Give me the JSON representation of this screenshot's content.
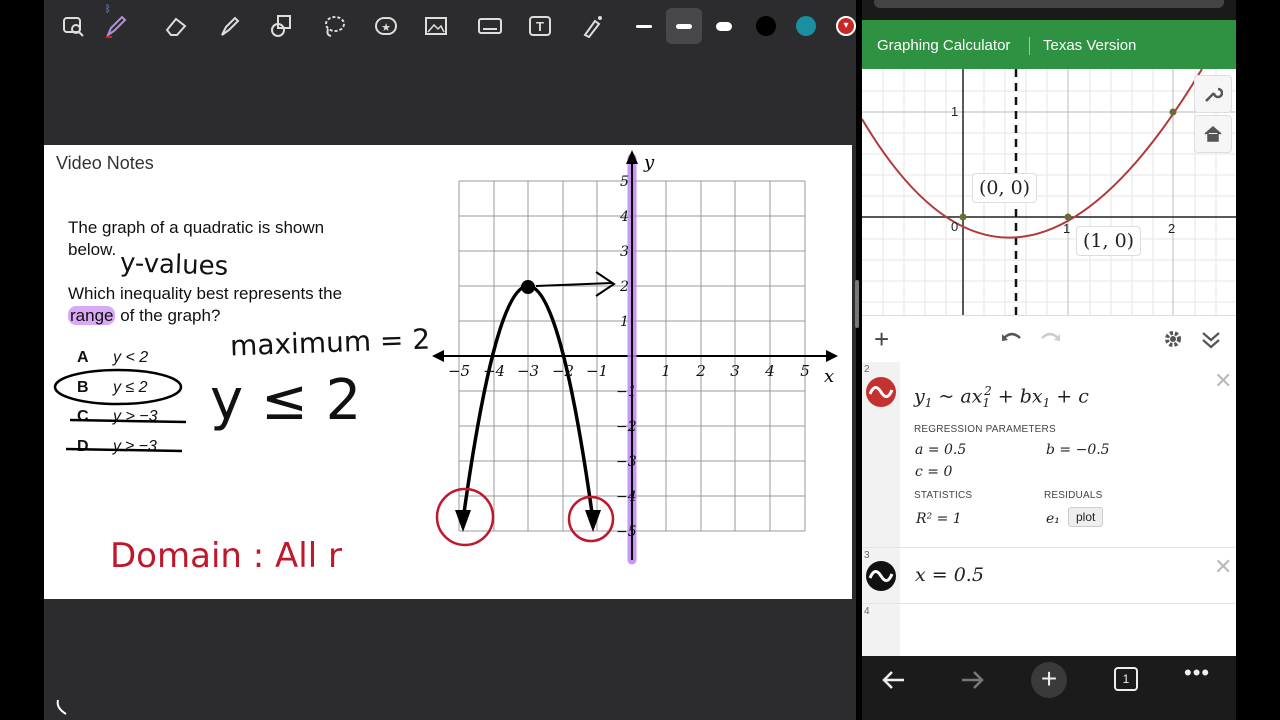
{
  "toolbar": {
    "bluetooth_icon": "bluetooth-icon",
    "tools": [
      "lasso-zoom-icon",
      "pen-icon",
      "eraser-icon",
      "highlighter-icon",
      "shapes-icon",
      "lasso-icon",
      "sticker-icon",
      "image-icon",
      "keyboard-icon",
      "text-icon",
      "laser-icon"
    ],
    "pen_colors": [
      "#000000",
      "#1a8fa0",
      "#c62828"
    ]
  },
  "notes": {
    "page_title": "Video Notes",
    "question_line1": "The graph of a quadratic is shown",
    "question_line2": "below.",
    "question_line3": "Which inequality best represents the",
    "question_range_word": "range",
    "question_line4_rest": " of the graph?",
    "options": [
      {
        "letter": "A",
        "text": "y < 2"
      },
      {
        "letter": "B",
        "text": "y ≤ 2"
      },
      {
        "letter": "C",
        "text": "y > −3"
      },
      {
        "letter": "D",
        "text": "y ≥ −3"
      }
    ],
    "handwriting": {
      "y_values": "y-values",
      "maximum": "maximum = 2",
      "answer": "y ≤ 2",
      "domain": "Domain : All r"
    },
    "graph": {
      "x_label": "x",
      "y_label": "y",
      "x_ticks": [
        "−5",
        "−4",
        "−3",
        "−2",
        "−1",
        "1",
        "2",
        "3",
        "4",
        "5"
      ],
      "y_ticks": [
        "5",
        "4",
        "3",
        "2",
        "1",
        "−1",
        "−2",
        "−3",
        "−4",
        "−5"
      ],
      "vertex_y_tick": "2"
    }
  },
  "calculator": {
    "header_left": "Graphing Calculator",
    "header_right": "Texas Version",
    "graph": {
      "label_0_0": "(0, 0)",
      "label_1_0": "(1, 0)",
      "x_ticks": [
        "0",
        "1",
        "2"
      ],
      "y_tick": "1"
    },
    "controls": {
      "add_icon": "plus-icon",
      "undo_icon": "undo-icon",
      "redo_icon": "redo-icon",
      "settings_icon": "gear-icon",
      "collapse_icon": "chevron-double-down-icon"
    },
    "expressions": [
      {
        "num": "2",
        "regression_header": "REGRESSION PARAMETERS",
        "a": "a = 0.5",
        "b": "b = −0.5",
        "c": "c = 0",
        "statistics_header": "STATISTICS",
        "residuals_header": "RESIDUALS",
        "r2": "R² = 1",
        "residual_var": "e₁",
        "plot_label": "plot"
      },
      {
        "num": "3",
        "expr": "x = 0.5"
      },
      {
        "num": "4"
      }
    ],
    "side_buttons": [
      "wrench-icon",
      "home-icon"
    ]
  },
  "browser_bar": {
    "icons": [
      "back-arrow-icon",
      "forward-arrow-icon",
      "new-tab-plus-icon",
      "tab-count-icon",
      "more-icon"
    ],
    "tab_count": "1"
  },
  "colors": {
    "calc_green": "#2f9142",
    "curve_red": "#b03a3a",
    "highlight_purple": "#c084f5",
    "annotation_red": "#c0182b"
  }
}
